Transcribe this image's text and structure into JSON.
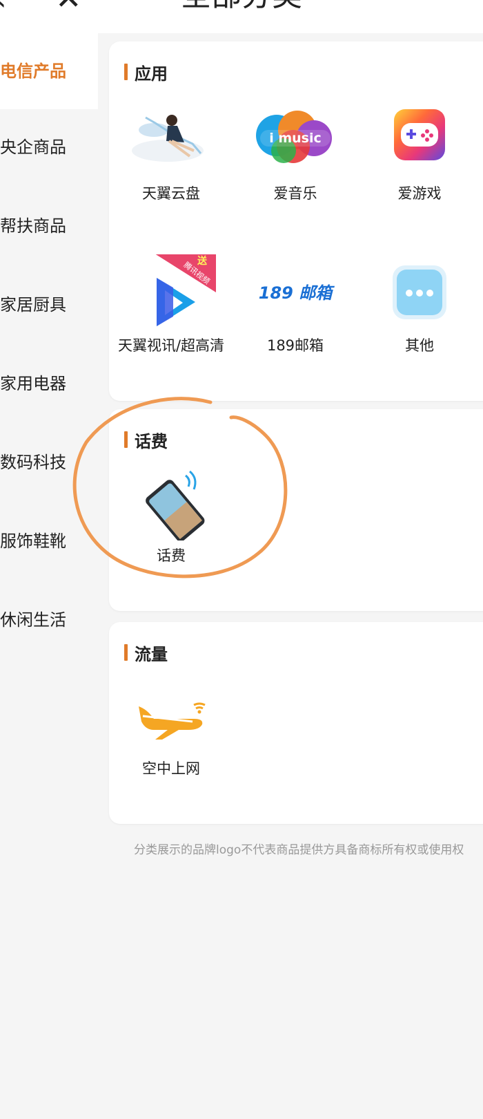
{
  "header": {
    "title": "全部分类"
  },
  "sidebar": {
    "items": [
      {
        "label": "电信产品",
        "active": true
      },
      {
        "label": "央企商品",
        "active": false
      },
      {
        "label": "帮扶商品",
        "active": false
      },
      {
        "label": "家居厨具",
        "active": false
      },
      {
        "label": "家用电器",
        "active": false
      },
      {
        "label": "数码科技",
        "active": false
      },
      {
        "label": "服饰鞋靴",
        "active": false
      },
      {
        "label": "休闲生活",
        "active": false
      }
    ]
  },
  "sections": [
    {
      "title": "应用",
      "items": [
        {
          "label": "天翼云盘",
          "icon": "cloud-drive-icon"
        },
        {
          "label": "爱音乐",
          "icon": "imusic-icon",
          "logo_text": "i music"
        },
        {
          "label": "爱游戏",
          "icon": "gamepad-icon"
        },
        {
          "label": "天翼视讯/超高清",
          "icon": "video-play-icon",
          "badge": "送",
          "ribbon": "腾讯视频"
        },
        {
          "label": "189邮箱",
          "icon": "mail-189-icon",
          "logo_text": "189 邮箱"
        },
        {
          "label": "其他",
          "icon": "more-dots-icon"
        }
      ]
    },
    {
      "title": "话费",
      "items": [
        {
          "label": "话费",
          "icon": "phone-signal-icon"
        }
      ]
    },
    {
      "title": "流量",
      "items": [
        {
          "label": "空中上网",
          "icon": "airplane-wifi-icon"
        }
      ]
    }
  ],
  "footnote": "分类展示的品牌logo不代表商品提供方具备商标所有权或使用权",
  "colors": {
    "accent": "#e07b2a",
    "annotation": "#ef9a53",
    "background": "#f5f5f5"
  }
}
